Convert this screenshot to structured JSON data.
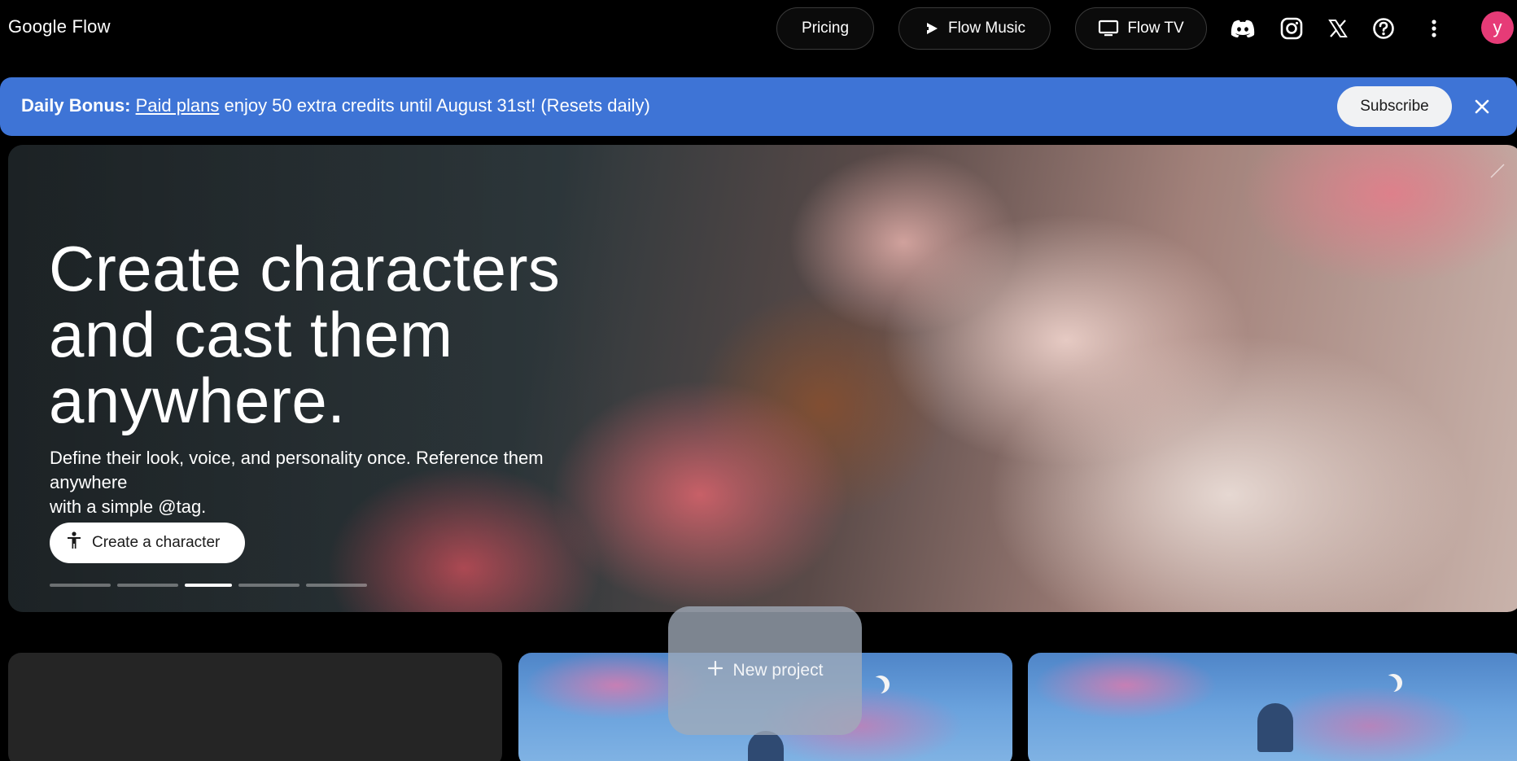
{
  "app": {
    "title": "Google Flow"
  },
  "nav": {
    "pricing": "Pricing",
    "flow_music": "Flow Music",
    "flow_tv": "Flow TV",
    "avatar_initial": "y"
  },
  "banner": {
    "bold": "Daily Bonus:",
    "link": "Paid plans",
    "message": "enjoy 50 extra credits until August 31st! (Resets daily)",
    "subscribe": "Subscribe"
  },
  "hero": {
    "title_line1": "Create characters",
    "title_line2": "and cast them",
    "title_line3": "anywhere.",
    "subtitle_line1": "Define their look, voice, and personality once. Reference them anywhere",
    "subtitle_line2": "with a simple @tag.",
    "cta": "Create a character",
    "carousel_slides": 5,
    "carousel_active_index": 2
  },
  "projects": {
    "new_project": "New project"
  },
  "colors": {
    "banner": "#3e74d6",
    "avatar": "#e63b77",
    "background": "#000000"
  }
}
